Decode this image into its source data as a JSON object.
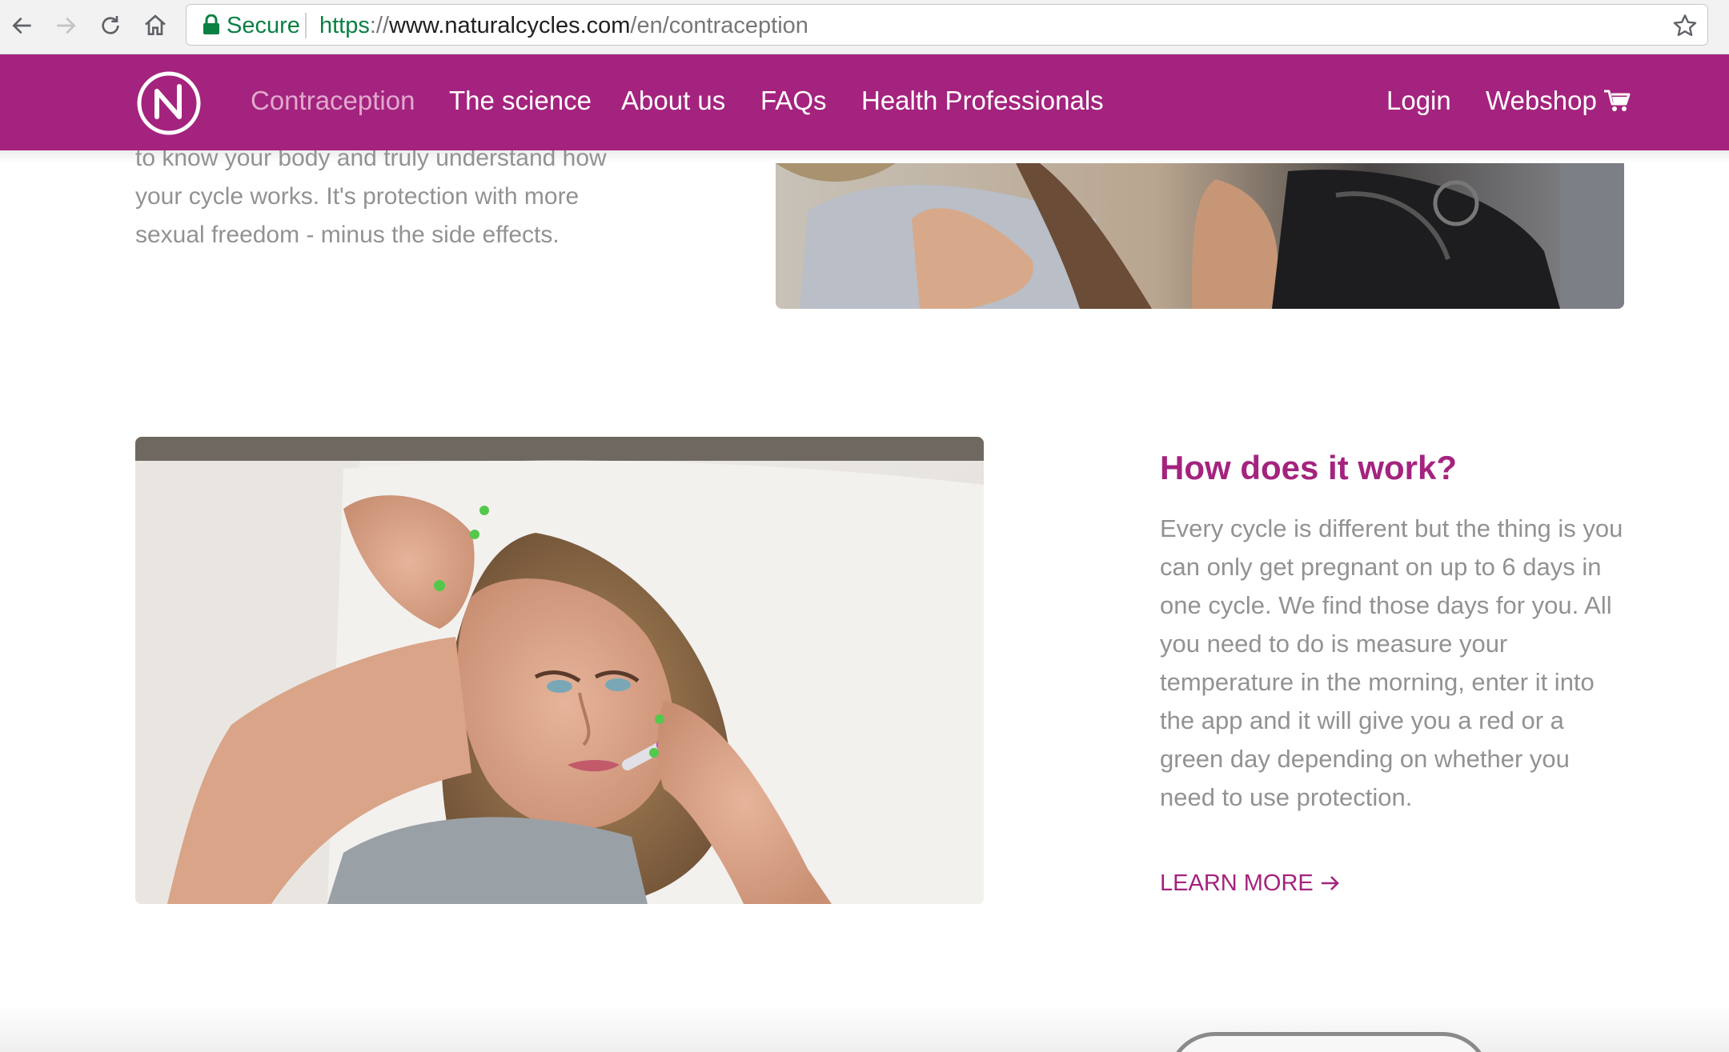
{
  "browser": {
    "secure_label": "Secure",
    "url_scheme": "https",
    "url_separator": "://",
    "url_host": "www.naturalcycles.com",
    "url_path": "/en/contraception"
  },
  "site_nav": {
    "logo_letter": "N",
    "links": [
      {
        "label": "Contraception",
        "active": true
      },
      {
        "label": "The science",
        "active": false
      },
      {
        "label": "About us",
        "active": false
      },
      {
        "label": "FAQs",
        "active": false
      },
      {
        "label": "Health Professionals",
        "active": false
      }
    ],
    "login_label": "Login",
    "webshop_label": "Webshop"
  },
  "intro": {
    "text": "to know your body and truly understand how your cycle works. It's protection with more sexual freedom - minus the side effects."
  },
  "how_it_works": {
    "title": "How does it work?",
    "body": "Every cycle is different but the thing is you can only get pregnant on up to 6 days in one cycle. We find those days for you. All you need to do is measure your temperature in the morning, enter it into the app and it will give you a red or a green day depending on whether you need to use protection.",
    "cta_label": "LEARN MORE"
  },
  "icons": {
    "back": "back-arrow-icon",
    "forward": "forward-arrow-icon",
    "reload": "reload-icon",
    "home": "home-icon",
    "lock": "lock-icon",
    "bookmark": "star-icon",
    "cart": "cart-icon",
    "arrow": "arrow-right-icon"
  },
  "colors": {
    "brand": "#a4237e",
    "nav_active": "#e0a9cd",
    "body_text": "#929292",
    "secure_green": "#0b8043"
  }
}
